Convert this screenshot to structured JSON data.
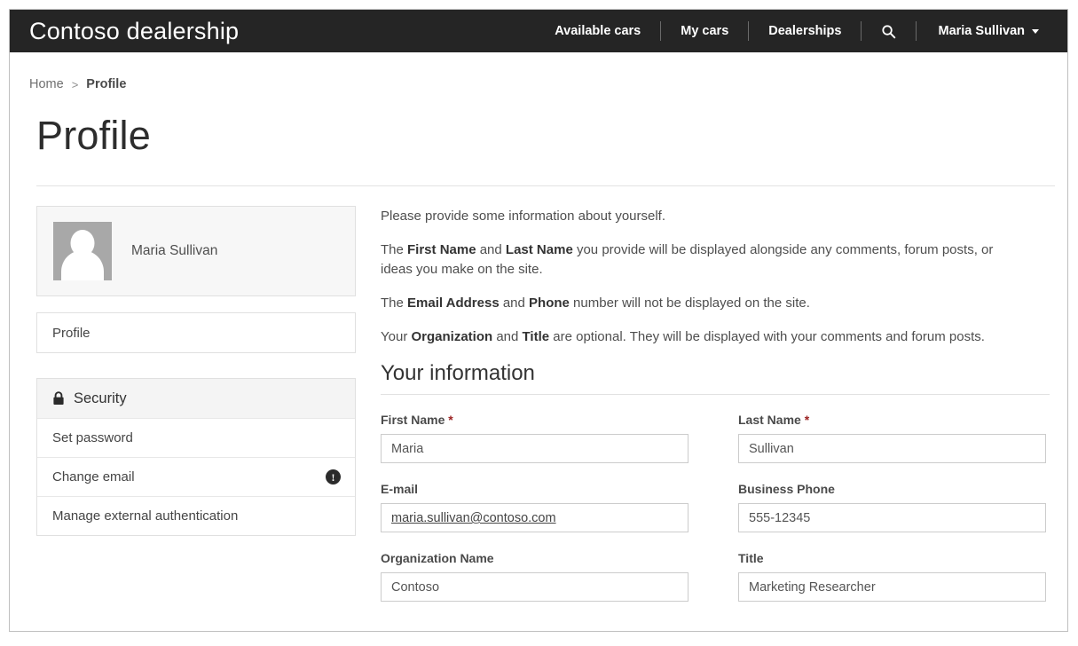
{
  "navbar": {
    "brand": "Contoso dealership",
    "links": [
      {
        "label": "Available cars"
      },
      {
        "label": "My cars"
      },
      {
        "label": "Dealerships"
      }
    ],
    "search_icon": "search-icon",
    "user": "Maria Sullivan"
  },
  "breadcrumb": {
    "home": "Home",
    "separator": ">",
    "current": "Profile"
  },
  "page": {
    "title": "Profile"
  },
  "sidebar": {
    "profile_card": {
      "name": "Maria Sullivan",
      "avatar": "person-placeholder-avatar"
    },
    "profile_menu": [
      {
        "label": "Profile"
      }
    ],
    "security": {
      "header": "Security",
      "header_icon": "lock-icon",
      "items": [
        {
          "label": "Set password",
          "badge": ""
        },
        {
          "label": "Change email",
          "badge": "!"
        },
        {
          "label": "Manage external authentication",
          "badge": ""
        }
      ]
    }
  },
  "main": {
    "intro": {
      "p1": "Please provide some information about yourself.",
      "p2": {
        "a": "The ",
        "b1": "First Name",
        "b": " and ",
        "b2": "Last Name",
        "c": " you provide will be displayed alongside any comments, forum posts, or ideas you make on the site."
      },
      "p3": {
        "a": "The ",
        "b1": "Email Address",
        "b": " and ",
        "b2": "Phone",
        "c": " number will not be displayed on the site."
      },
      "p4": {
        "a": "Your ",
        "b1": "Organization",
        "b": " and ",
        "b2": "Title",
        "c": " are optional. They will be displayed with your comments and forum posts."
      }
    },
    "section_title": "Your information",
    "fields": {
      "first_name": {
        "label": "First Name",
        "required": "*",
        "value": "Maria"
      },
      "last_name": {
        "label": "Last Name",
        "required": "*",
        "value": "Sullivan"
      },
      "email": {
        "label": "E-mail",
        "value": "maria.sullivan@contoso.com"
      },
      "business_phone": {
        "label": "Business Phone",
        "value": "555-12345"
      },
      "organization": {
        "label": "Organization Name",
        "value": "Contoso"
      },
      "title": {
        "label": "Title",
        "value": "Marketing Researcher"
      }
    }
  },
  "colors": {
    "navbar_bg": "#252525",
    "required_asterisk": "#9b2222",
    "card_bg": "#f7f7f7",
    "border": "#e0e0e0"
  }
}
